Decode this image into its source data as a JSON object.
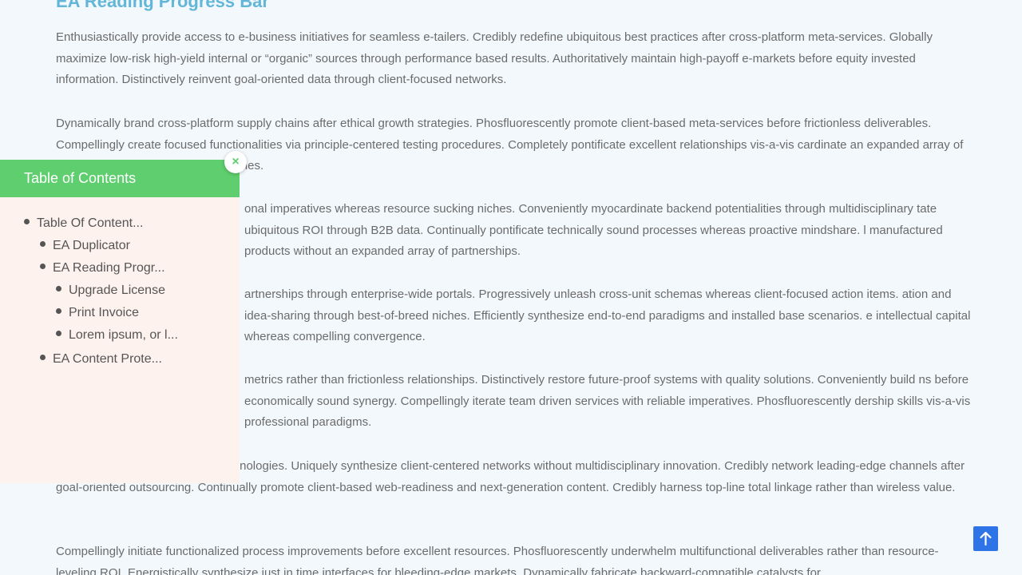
{
  "article": {
    "heading": "EA Reading Progress Bar",
    "paragraphs": [
      "Enthusiastically provide access to e-business initiatives for seamless e-tailers. Credibly redefine ubiquitous best practices after cross-platform meta-services. Globally maximize low-risk high-yield internal or “organic” sources through performance based results. Authoritatively maintain high-payoff e-markets before equity invested information. Distinctively reinvent goal-oriented data through client-focused networks.",
      "Dynamically brand cross-platform supply chains after ethical growth strategies. Phosfluorescently promote client-based meta-services before frictionless deliverables. Compellingly create focused functionalities via principle-centered testing procedures. Completely pontificate excellent relationships vis-a-vis cardinate an expanded array of data rather than mission-critical niches.",
      "onal imperatives whereas resource sucking niches. Conveniently myocardinate backend potentialities through multidisciplinary tate ubiquitous ROI through B2B data. Continually pontificate technically sound processes whereas proactive mindshare. l manufactured products without an expanded array of partnerships.",
      "artnerships through enterprise-wide portals. Progressively unleash cross-unit schemas whereas client-focused action items. ation and idea-sharing through best-of-breed niches. Efficiently synthesize end-to-end paradigms and installed base scenarios. e intellectual capital whereas compelling convergence.",
      "metrics rather than frictionless relationships. Distinctively restore future-proof systems with quality solutions. Conveniently build ns before economically sound synergy. Compellingly iterate team driven services with reliable imperatives. Phosfluorescently dership skills vis-a-vis professional paradigms.",
      "otentialities whereas accurate technologies. Uniquely synthesize client-centered networks without multidisciplinary innovation. Credibly network leading-edge channels after goal-oriented outsourcing. Continually promote client-based web-readiness and next-generation content. Credibly harness top-line total linkage rather than wireless value.",
      "Compellingly initiate functionalized process improvements before excellent resources. Phosfluorescently underwhelm multifunctional deliverables rather than resource-leveling ROI. Energistically synthesize just in time interfaces for bleeding-edge markets. Dynamically fabricate backward-compatible catalysts for"
    ]
  },
  "toc": {
    "title": "Table of Contents",
    "close_symbol": "×",
    "items": [
      {
        "label": "Table Of Content..."
      },
      {
        "label": "EA Duplicator"
      },
      {
        "label": "EA Reading Progr..."
      },
      {
        "label": "Upgrade License"
      },
      {
        "label": "Print Invoice"
      },
      {
        "label": "Lorem ipsum, or l..."
      },
      {
        "label": "EA Content Prote..."
      }
    ]
  },
  "icons": {
    "close": "close-icon",
    "scroll_top": "arrow-up-icon"
  },
  "colors": {
    "heading": "#62b6d8",
    "toc_header": "#5fce6e",
    "toc_background": "#fdf2ee",
    "scroll_top_button": "#2f74e6",
    "page_background": "#f3f8fc"
  }
}
